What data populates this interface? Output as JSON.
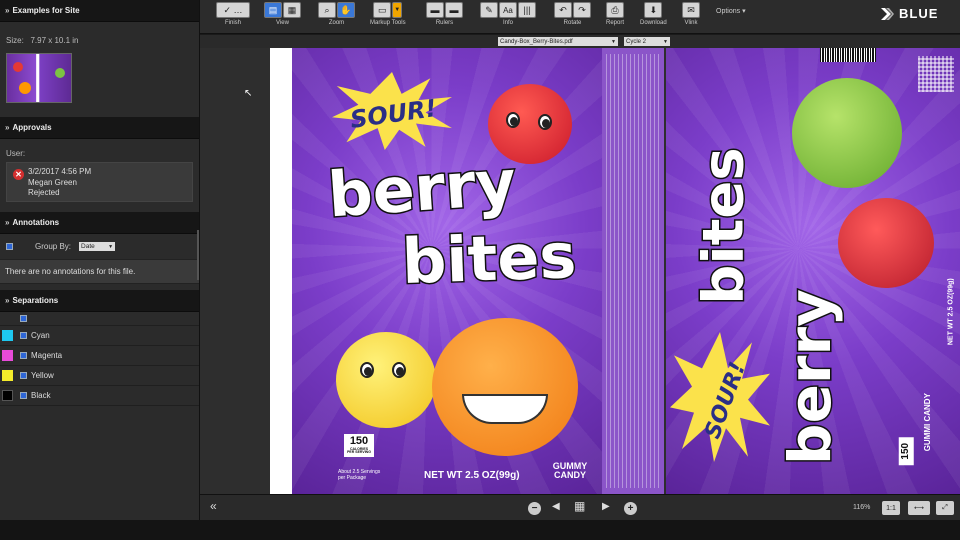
{
  "sidebar": {
    "title": "Examples for Site",
    "size_label": "Size:",
    "size_value": "7.97 x 10.1 in",
    "approvals": {
      "heading": "Approvals",
      "user_label": "User:",
      "entry": {
        "date": "3/2/2017 4:56 PM",
        "name": "Megan Green",
        "status": "Rejected"
      }
    },
    "annotations": {
      "heading": "Annotations",
      "group_by_label": "Group By:",
      "group_by_value": "Date",
      "empty_message": "There are no annotations for this file."
    },
    "separations": {
      "heading": "Separations",
      "items": [
        {
          "name": "Cyan",
          "color": "#1ec8f0"
        },
        {
          "name": "Magenta",
          "color": "#e84bd9"
        },
        {
          "name": "Yellow",
          "color": "#f5ec2b"
        },
        {
          "name": "Black",
          "color": "#000000"
        }
      ]
    }
  },
  "toolbar": {
    "groups": [
      {
        "label": "Finish"
      },
      {
        "label": "View"
      },
      {
        "label": "Zoom"
      },
      {
        "label": "Markup Tools"
      },
      {
        "label": "Rulers"
      },
      {
        "label": "Info"
      },
      {
        "label": "Rotate"
      },
      {
        "label": "Report"
      },
      {
        "label": "Download"
      },
      {
        "label": "Vlink"
      }
    ],
    "options_label": "Options ▾",
    "brand": "BLUE"
  },
  "docbar": {
    "file": "Candy-Box_Berry-Bites.pdf",
    "cycle": "Cycle 2"
  },
  "artwork": {
    "sour": "SOUR!",
    "word1": "berry",
    "word2": "bites",
    "calories": "150",
    "calories_caption": "CALORIES PER SERVING",
    "servings": "About 2.5 Servings per Package",
    "net_wt": "NET WT 2.5 OZ(99g)",
    "gummy": "GUMMY CANDY",
    "side_net_wt": "NET WT 2.5 OZ(99g)",
    "side_gummi": "GUMMI CANDY"
  },
  "bottombar": {
    "zoom": "116%",
    "actual_size": "1:1"
  }
}
